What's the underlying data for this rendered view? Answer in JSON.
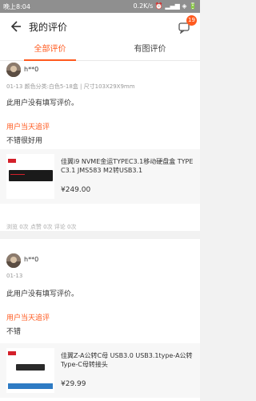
{
  "status": {
    "left": "晚上8:04",
    "right": "0.2K/s ⏰ ▂▄▆ ◈ 🔋"
  },
  "header": {
    "title": "我的评价",
    "badge": "19"
  },
  "tabs": [
    {
      "label": "全部评价",
      "active": true
    },
    {
      "label": "有图评价",
      "active": false
    }
  ],
  "reviews": [
    {
      "user": "h**0",
      "meta": "01-13  颜色分类:白色5-18盒 | 尺寸103X29X9mm",
      "text": "此用户没有填写评价。",
      "followup_title": "用户当天追评",
      "followup_text": "不错很好用",
      "product_name": "佳翼i9 NVME金运TYPEC3.1移动硬盘盒 TYPE C3.1 JMS583 M2转USB3.1",
      "product_price": "¥249.00",
      "stats": "浏览 0次  点赞 0次  评论 0次"
    },
    {
      "user": "h**0",
      "meta": "01-13",
      "text": "此用户没有填写评价。",
      "followup_title": "用户当天追评",
      "followup_text": "不错",
      "product_name": "佳翼Z-A公转C母 USB3.0 USB3.1type-A公转Type-C母转接头",
      "product_price": "¥29.99"
    }
  ],
  "colors": {
    "accent": "#ff5a1f",
    "status_bar": "#8f8f8f"
  },
  "icons": {
    "back": "arrow-left-icon",
    "message": "message-icon"
  }
}
